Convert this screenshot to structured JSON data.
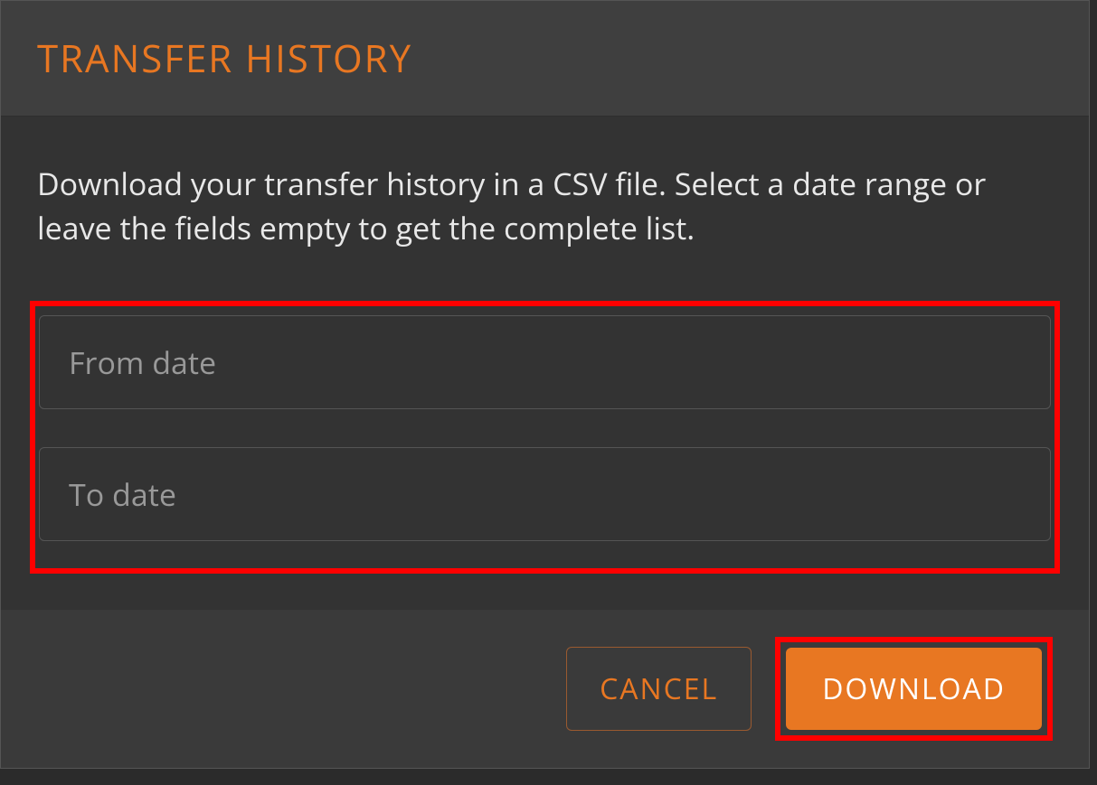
{
  "header": {
    "title": "TRANSFER HISTORY"
  },
  "body": {
    "description": "Download your transfer history in a CSV file. Select a date range or leave the fields empty to get the complete list.",
    "from_date": {
      "placeholder": "From date",
      "value": ""
    },
    "to_date": {
      "placeholder": "To date",
      "value": ""
    }
  },
  "footer": {
    "cancel_label": "CANCEL",
    "download_label": "DOWNLOAD"
  }
}
